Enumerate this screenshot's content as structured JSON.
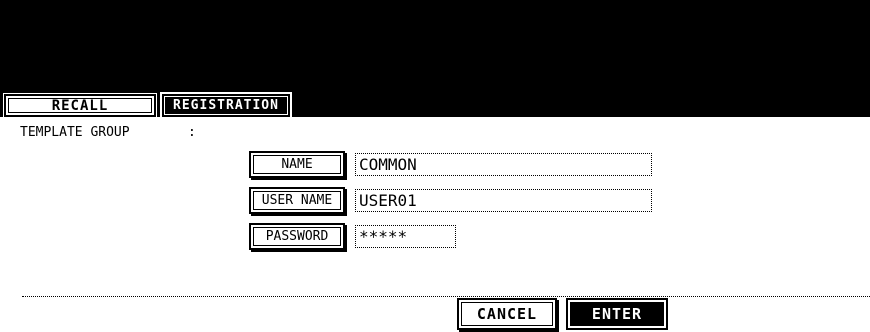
{
  "tabs": {
    "recall": "RECALL",
    "registration": "REGISTRATION"
  },
  "template_group": {
    "label": "TEMPLATE GROUP",
    "separator": ":"
  },
  "fields": {
    "name": {
      "button": "NAME",
      "value": "COMMON"
    },
    "user_name": {
      "button": "USER NAME",
      "value": "USER01"
    },
    "password": {
      "button": "PASSWORD",
      "value": "*****"
    }
  },
  "actions": {
    "cancel": "CANCEL",
    "enter": "ENTER"
  }
}
